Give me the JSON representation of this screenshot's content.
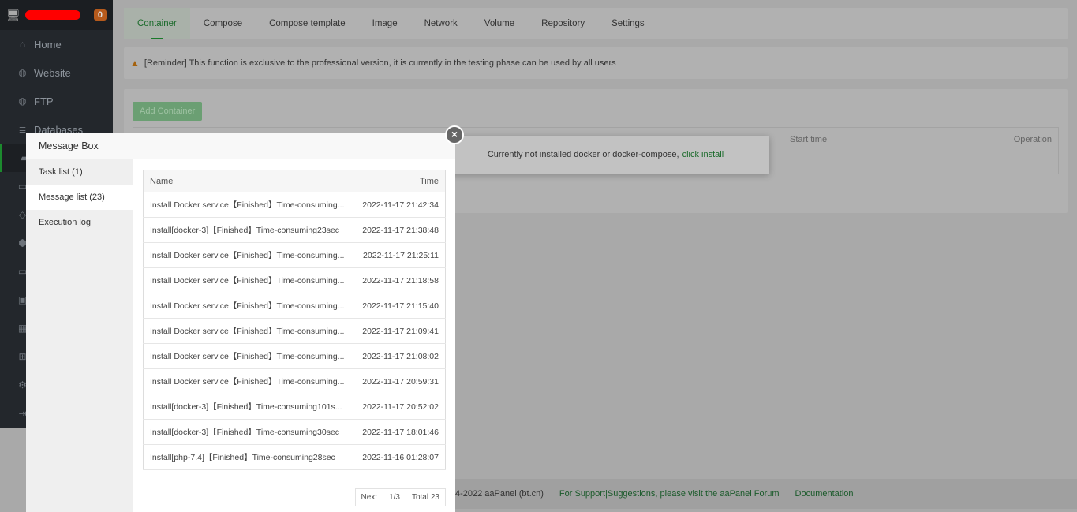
{
  "sidebar": {
    "badge": "0",
    "items": [
      {
        "label": "Home",
        "icon": "home-icon"
      },
      {
        "label": "Website",
        "icon": "globe-icon"
      },
      {
        "label": "FTP",
        "icon": "ftp-icon"
      },
      {
        "label": "Databases",
        "icon": "database-icon"
      }
    ]
  },
  "tabs": [
    "Container",
    "Compose",
    "Compose template",
    "Image",
    "Network",
    "Volume",
    "Repository",
    "Settings"
  ],
  "reminder": "[Reminder] This function is exclusive to the professional version, it is currently in the testing phase can be used by all users",
  "add_container": "Add Container",
  "table_headers": {
    "start_time": "Start time",
    "operation": "Operation"
  },
  "docker_msg": {
    "text": "Currently not installed docker or docker-compose,",
    "link": "click install"
  },
  "footer": {
    "copyright": "4-2022 aaPanel (bt.cn)",
    "support": "For Support|Suggestions, please visit the aaPanel Forum",
    "docs": "Documentation"
  },
  "modal": {
    "title": "Message Box",
    "nav": [
      "Task list (1)",
      "Message list (23)",
      "Execution log"
    ],
    "headers": {
      "name": "Name",
      "time": "Time"
    },
    "rows": [
      [
        "Install Docker service【Finished】Time-consuming...",
        "2022-11-17 21:42:34"
      ],
      [
        "Install[docker-3]【Finished】Time-consuming23sec",
        "2022-11-17 21:38:48"
      ],
      [
        "Install Docker service【Finished】Time-consuming...",
        "2022-11-17 21:25:11"
      ],
      [
        "Install Docker service【Finished】Time-consuming...",
        "2022-11-17 21:18:58"
      ],
      [
        "Install Docker service【Finished】Time-consuming...",
        "2022-11-17 21:15:40"
      ],
      [
        "Install Docker service【Finished】Time-consuming...",
        "2022-11-17 21:09:41"
      ],
      [
        "Install Docker service【Finished】Time-consuming...",
        "2022-11-17 21:08:02"
      ],
      [
        "Install Docker service【Finished】Time-consuming...",
        "2022-11-17 20:59:31"
      ],
      [
        "Install[docker-3]【Finished】Time-consuming101s...",
        "2022-11-17 20:52:02"
      ],
      [
        "Install[docker-3]【Finished】Time-consuming30sec",
        "2022-11-17 18:01:46"
      ],
      [
        "Install[php-7.4]【Finished】Time-consuming28sec",
        "2022-11-16 01:28:07"
      ]
    ],
    "pager": {
      "next": "Next",
      "page": "1/3",
      "total": "Total 23"
    }
  }
}
